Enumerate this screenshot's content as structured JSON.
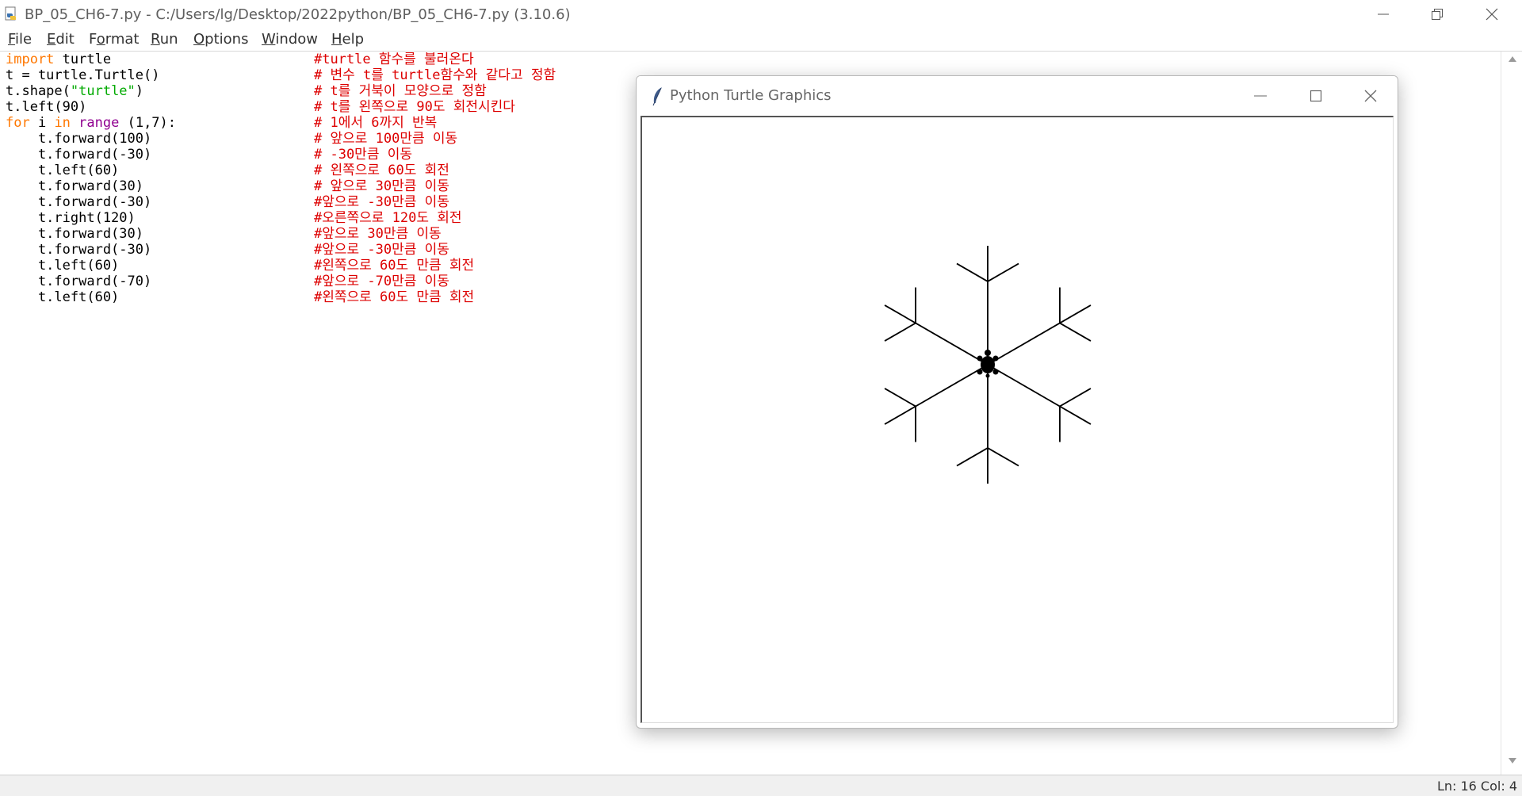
{
  "window": {
    "title": "BP_05_CH6-7.py - C:/Users/lg/Desktop/2022python/BP_05_CH6-7.py (3.10.6)",
    "icon": "python-file-icon"
  },
  "menubar": {
    "items": [
      {
        "accel": "F",
        "rest": "ile"
      },
      {
        "accel": "E",
        "rest": "dit"
      },
      {
        "accel": "",
        "rest": "F",
        "accel2": "o",
        "rest2": "rmat"
      },
      {
        "accel": "R",
        "rest": "un"
      },
      {
        "accel": "O",
        "rest": "ptions"
      },
      {
        "accel": "W",
        "rest": "indow"
      },
      {
        "accel": "H",
        "rest": "elp"
      }
    ]
  },
  "editor": {
    "code_lines": [
      {
        "segments": [
          {
            "t": "import",
            "c": "kw"
          },
          {
            "t": " turtle",
            "c": ""
          }
        ],
        "comment": "#turtle 함수를 불러온다"
      },
      {
        "segments": [
          {
            "t": "t = turtle.Turtle()",
            "c": ""
          }
        ],
        "comment": "# 변수 t를 turtle함수와 같다고 정함"
      },
      {
        "segments": [
          {
            "t": "t.shape(",
            "c": ""
          },
          {
            "t": "\"turtle\"",
            "c": "str"
          },
          {
            "t": ")",
            "c": ""
          }
        ],
        "comment": "# t를 거북이 모양으로 정함"
      },
      {
        "segments": [
          {
            "t": "t.left(90)",
            "c": ""
          }
        ],
        "comment": "# t를 왼쪽으로 90도 회전시킨다"
      },
      {
        "segments": [
          {
            "t": "for",
            "c": "kw"
          },
          {
            "t": " i ",
            "c": ""
          },
          {
            "t": "in",
            "c": "kw"
          },
          {
            "t": " ",
            "c": ""
          },
          {
            "t": "range",
            "c": "bi"
          },
          {
            "t": " (1,7):",
            "c": ""
          }
        ],
        "comment": "# 1에서 6까지 반복"
      },
      {
        "segments": [
          {
            "t": "    t.forward(100)",
            "c": ""
          }
        ],
        "comment": "# 앞으로 100만큼 이동"
      },
      {
        "segments": [
          {
            "t": "    t.forward(-30)",
            "c": ""
          }
        ],
        "comment": "# -30만큼 이동"
      },
      {
        "segments": [
          {
            "t": "    t.left(60)",
            "c": ""
          }
        ],
        "comment": "# 왼쪽으로 60도 회전"
      },
      {
        "segments": [
          {
            "t": "    t.forward(30)",
            "c": ""
          }
        ],
        "comment": "# 앞으로 30만큼 이동"
      },
      {
        "segments": [
          {
            "t": "    t.forward(-30)",
            "c": ""
          }
        ],
        "comment": "#앞으로 -30만큼 이동"
      },
      {
        "segments": [
          {
            "t": "    t.right(120)",
            "c": ""
          }
        ],
        "comment": "#오른쪽으로 120도 회전"
      },
      {
        "segments": [
          {
            "t": "    t.forward(30)",
            "c": ""
          }
        ],
        "comment": "#앞으로 30만큼 이동"
      },
      {
        "segments": [
          {
            "t": "    t.forward(-30)",
            "c": ""
          }
        ],
        "comment": "#앞으로 -30만큼 이동"
      },
      {
        "segments": [
          {
            "t": "    t.left(60)",
            "c": ""
          }
        ],
        "comment": "#왼쪽으로 60도 만큼 회전"
      },
      {
        "segments": [
          {
            "t": "    t.forward(-70)",
            "c": ""
          }
        ],
        "comment": "#앞으로 -70만큼 이동"
      },
      {
        "segments": [
          {
            "t": "    t.left(60)",
            "c": ""
          }
        ],
        "comment": "#왼쪽으로 60도 만큼 회전"
      }
    ]
  },
  "status": {
    "position": "Ln: 16   Col: 4"
  },
  "turtle_window": {
    "title": "Python Turtle Graphics",
    "icon": "feather-icon",
    "drawing": {
      "start_heading_deg": 90,
      "repeat": 6,
      "steps": [
        [
          "forward",
          100
        ],
        [
          "forward",
          -30
        ],
        [
          "left",
          60
        ],
        [
          "forward",
          30
        ],
        [
          "forward",
          -30
        ],
        [
          "right",
          120
        ],
        [
          "forward",
          30
        ],
        [
          "forward",
          -30
        ],
        [
          "left",
          60
        ],
        [
          "forward",
          -70
        ],
        [
          "left",
          60
        ]
      ],
      "line_color": "#000000",
      "turtle_shape": "turtle"
    }
  },
  "colors": {
    "keyword": "#ff7700",
    "builtin": "#900090",
    "string": "#00aa00",
    "comment": "#dd0000"
  }
}
